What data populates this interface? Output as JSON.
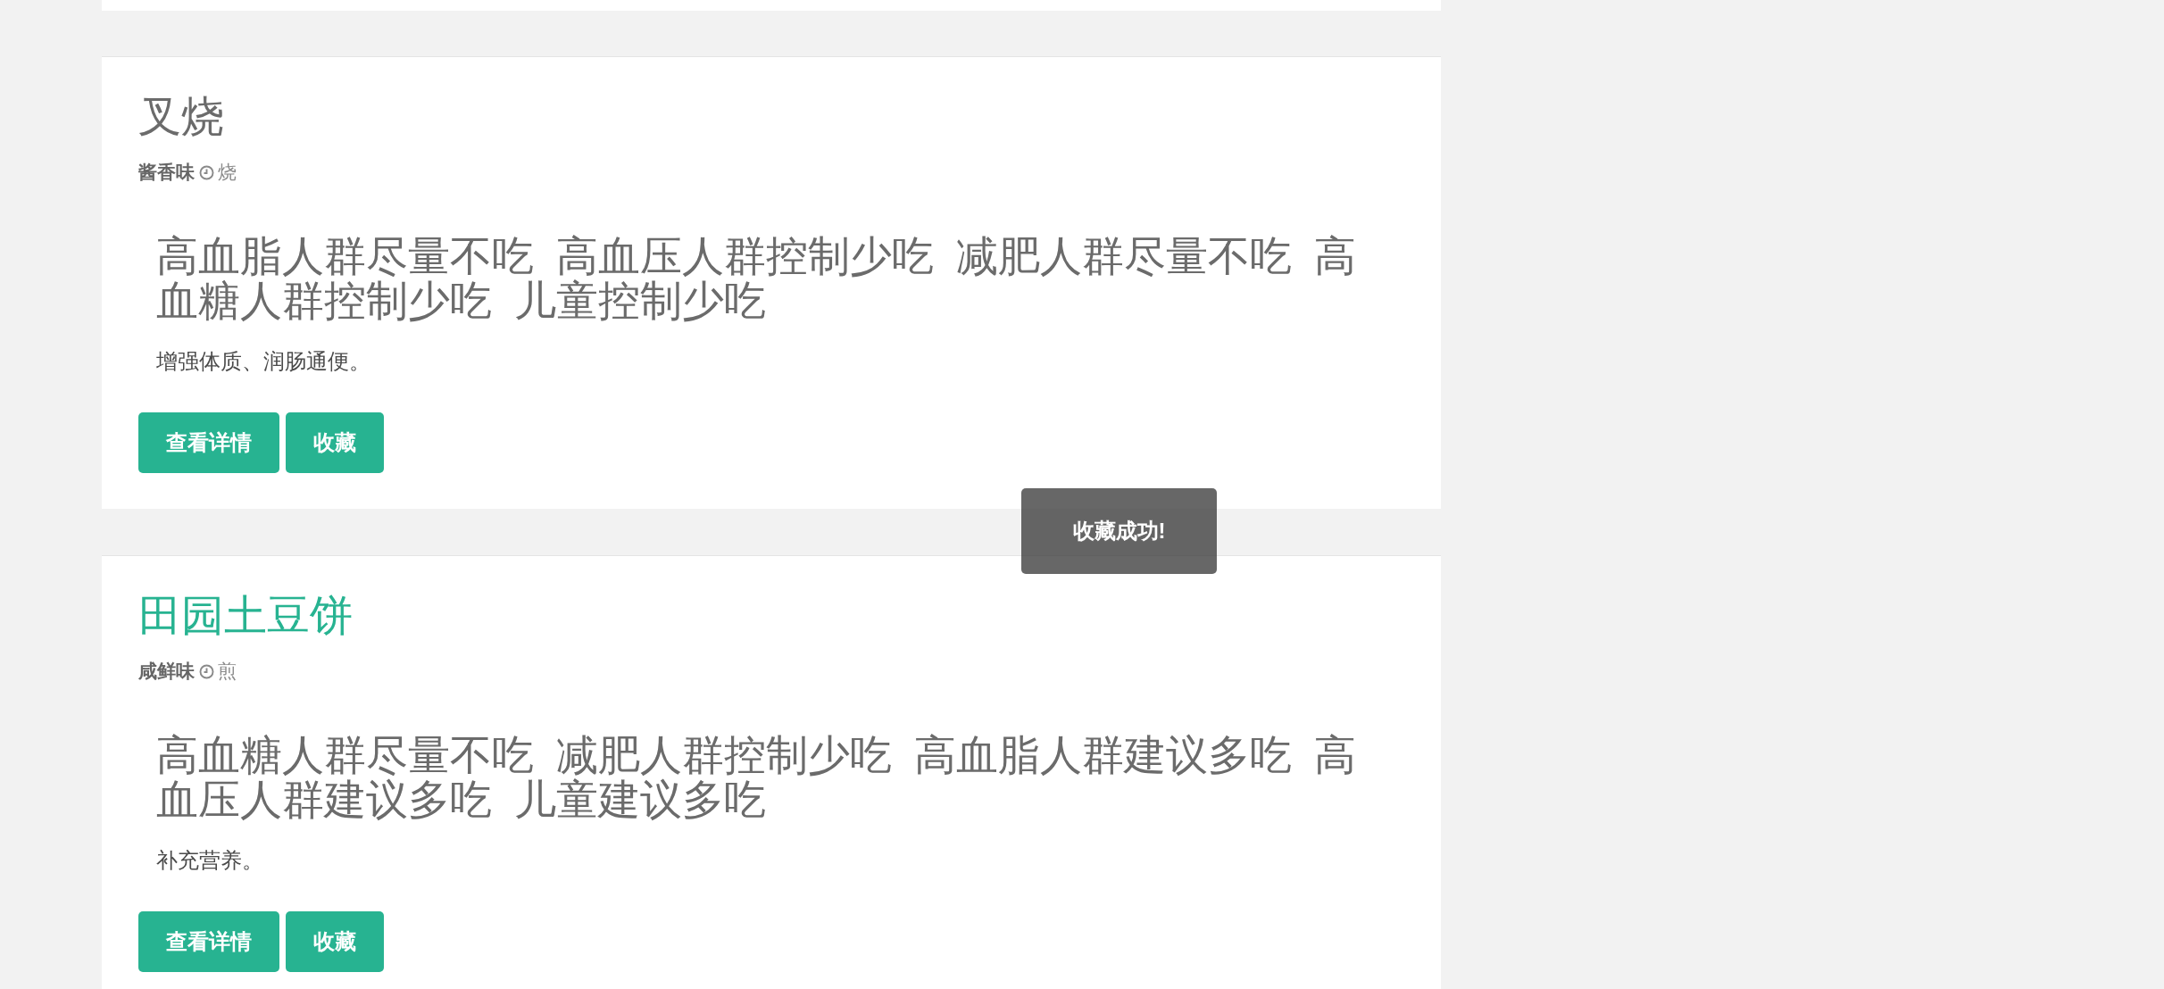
{
  "cards": [
    {
      "title": "叉烧",
      "hovered": false,
      "flavor": "酱香味",
      "method": "烧",
      "advice": "高血脂人群尽量不吃 高血压人群控制少吃 减肥人群尽量不吃 高血糖人群控制少吃 儿童控制少吃",
      "benefit": "增强体质、润肠通便。",
      "buttons": [
        "查看详情",
        "收藏"
      ]
    },
    {
      "title": "田园土豆饼",
      "hovered": true,
      "flavor": "咸鲜味",
      "method": "煎",
      "advice": "高血糖人群尽量不吃 减肥人群控制少吃 高血脂人群建议多吃 高血压人群建议多吃 儿童建议多吃",
      "benefit": "补充营养。",
      "buttons": [
        "查看详情",
        "收藏"
      ]
    }
  ],
  "toast": {
    "message": "收藏成功!"
  }
}
